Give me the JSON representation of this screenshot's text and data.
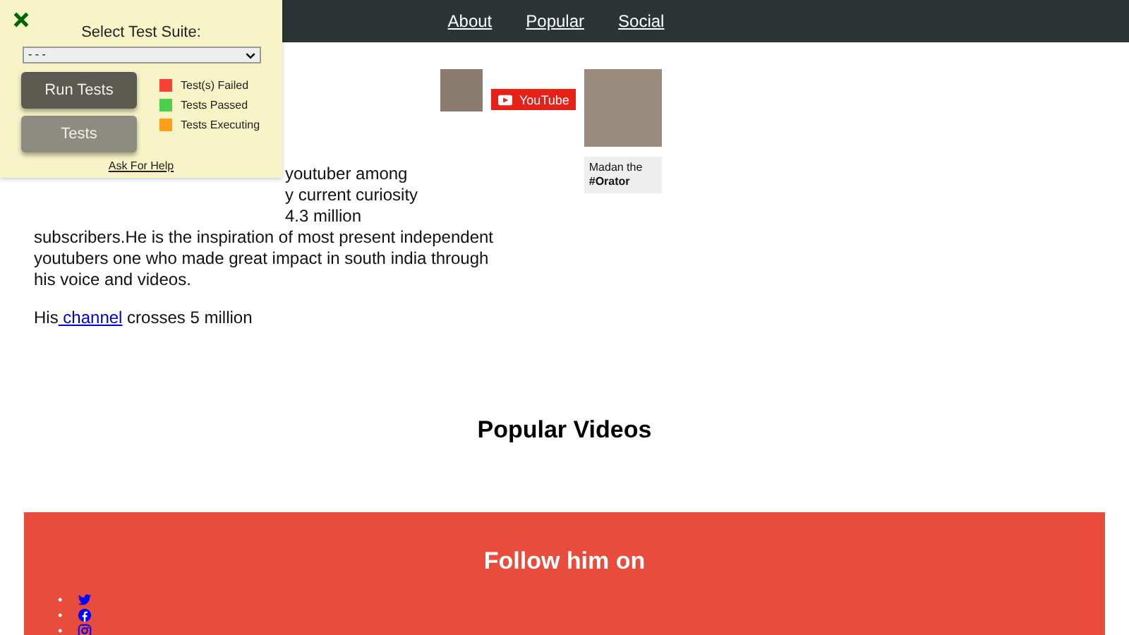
{
  "nav": {
    "links": [
      "About",
      "Popular",
      "Social"
    ]
  },
  "about": {
    "paragraph_lines": [
      {
        "text": "youtuber among",
        "kind": "partly_hidden"
      },
      {
        "text": "y current curiosity",
        "kind": "partly_hidden"
      },
      {
        "text": "4.3 million",
        "kind": "partly_hidden"
      },
      {
        "text": "subscribers.He is the inspiration of most present independent",
        "kind": "full"
      },
      {
        "text": "youtubers one who made great impact in south india through",
        "kind": "full"
      },
      {
        "text": "his voice and videos.",
        "kind": "full"
      }
    ],
    "channel_line": {
      "before": "His",
      "link": " channel",
      "after": " crosses 5 million"
    }
  },
  "media": {
    "youtube_button": "YouTube",
    "caption": "Madan the **#Orator**"
  },
  "popular": {
    "heading": "Popular Videos"
  },
  "footer": {
    "heading": "Follow him on",
    "social": [
      {
        "kind": "twitter",
        "marker": "•"
      },
      {
        "kind": "facebook",
        "marker": "•"
      },
      {
        "kind": "instagram",
        "marker": "•"
      }
    ]
  },
  "test_panel": {
    "title": "Select Test Suite:",
    "select_value": "- - -",
    "buttons": [
      {
        "label": "Run Tests",
        "kind": "primary"
      },
      {
        "label": "Tests",
        "kind": "secondary"
      }
    ],
    "legend": [
      {
        "label": "Test(s) Failed",
        "color": "#f44336"
      },
      {
        "label": "Tests Passed",
        "color": "#4cd04c"
      },
      {
        "label": "Tests Executing",
        "color": "#ff9f1c"
      }
    ],
    "help_link": "Ask For Help"
  }
}
